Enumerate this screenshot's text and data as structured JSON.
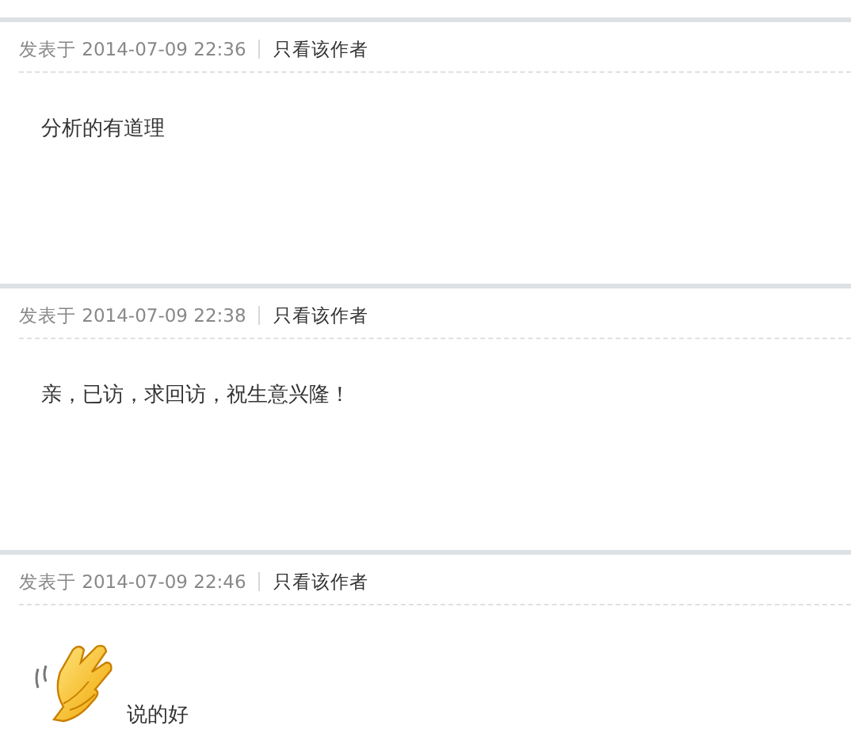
{
  "posts": [
    {
      "posted_label": "发表于",
      "time": "2014-07-09 22:36",
      "author_link": "只看该作者",
      "kind": "text",
      "content": "分析的有道理"
    },
    {
      "posted_label": "发表于",
      "time": "2014-07-09 22:38",
      "author_link": "只看该作者",
      "kind": "text",
      "content": "亲，已访，求回访，祝生意兴隆！"
    },
    {
      "posted_label": "发表于",
      "time": "2014-07-09 22:46",
      "author_link": "只看该作者",
      "kind": "emoji_text",
      "content": "说的好"
    }
  ]
}
